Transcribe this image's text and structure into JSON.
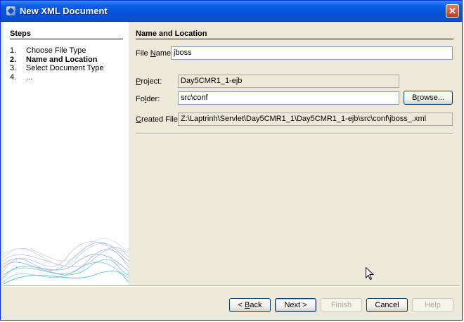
{
  "window": {
    "title": "New XML Document",
    "close_label": "✕"
  },
  "steps": {
    "title": "Steps",
    "items": [
      {
        "num": "1.",
        "label": "Choose File Type"
      },
      {
        "num": "2.",
        "label": "Name and Location"
      },
      {
        "num": "3.",
        "label": "Select Document Type"
      },
      {
        "num": "4.",
        "label": "..."
      }
    ],
    "active_index": 1
  },
  "form": {
    "section_title": "Name and Location",
    "file_name": {
      "label_pre": "File ",
      "label_u": "N",
      "label_post": "ame:",
      "value": "jboss"
    },
    "project": {
      "label_u": "P",
      "label_post": "roject:",
      "value": "Day5CMR1_1-ejb"
    },
    "folder": {
      "label_pre": "Fo",
      "label_u": "l",
      "label_post": "der:",
      "value": "src\\conf",
      "browse_pre": "B",
      "browse_u": "r",
      "browse_post": "owse..."
    },
    "created_file": {
      "label_u": "C",
      "label_post": "reated File:",
      "value": "Z:\\Laptrinh\\Servlet\\Day5CMR1_1\\Day5CMR1_1-ejb\\src\\conf\\jboss_.xml"
    }
  },
  "buttons": {
    "back_pre": "< ",
    "back_u": "B",
    "back_post": "ack",
    "next": "Next >",
    "finish": "Finish",
    "cancel": "Cancel",
    "help": "Help"
  },
  "icons": {
    "title": "xml-document-icon",
    "close": "close-icon",
    "cursor": "mouse-pointer-icon"
  },
  "colors": {
    "titlebar": "#0553d8",
    "window_bg": "#ece9d8",
    "close": "#c73a1c"
  }
}
